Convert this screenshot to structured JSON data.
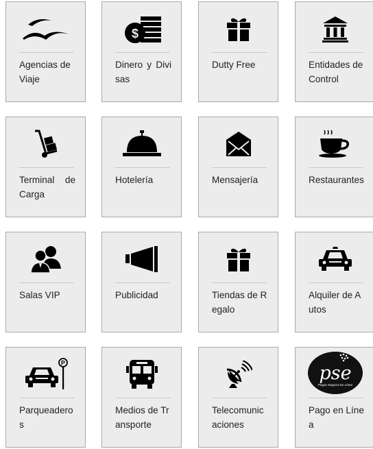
{
  "tiles": [
    {
      "label": "Agencias de Viaje",
      "icon": "seagulls-icon"
    },
    {
      "label": "Dinero y Divisas",
      "icon": "money-bag-bills-icon"
    },
    {
      "label": "Dutty Free",
      "icon": "gift-icon"
    },
    {
      "label": "Entidades de Control",
      "icon": "government-building-icon"
    },
    {
      "label": "Terminal de Carga",
      "icon": "hand-truck-icon"
    },
    {
      "label": "Hotelería",
      "icon": "service-bell-icon"
    },
    {
      "label": "Mensajería",
      "icon": "envelope-icon"
    },
    {
      "label": "Restaurantes",
      "icon": "coffee-cup-icon"
    },
    {
      "label": "Salas VIP",
      "icon": "people-icon"
    },
    {
      "label": "Publicidad",
      "icon": "megaphone-icon"
    },
    {
      "label": "Tiendas de Regalo",
      "icon": "gift-icon"
    },
    {
      "label": "Alquiler de Autos",
      "icon": "car-icon"
    },
    {
      "label": "Parqueaderos",
      "icon": "parking-car-icon"
    },
    {
      "label": "Medios de Transporte",
      "icon": "bus-icon"
    },
    {
      "label": "Telecomunicaciones",
      "icon": "satellite-dish-icon"
    },
    {
      "label": "Pago en Línea",
      "icon": "pse-logo"
    }
  ],
  "pse_logo": {
    "text": "pse",
    "subtitle": "Pagos Seguros En Línea"
  }
}
